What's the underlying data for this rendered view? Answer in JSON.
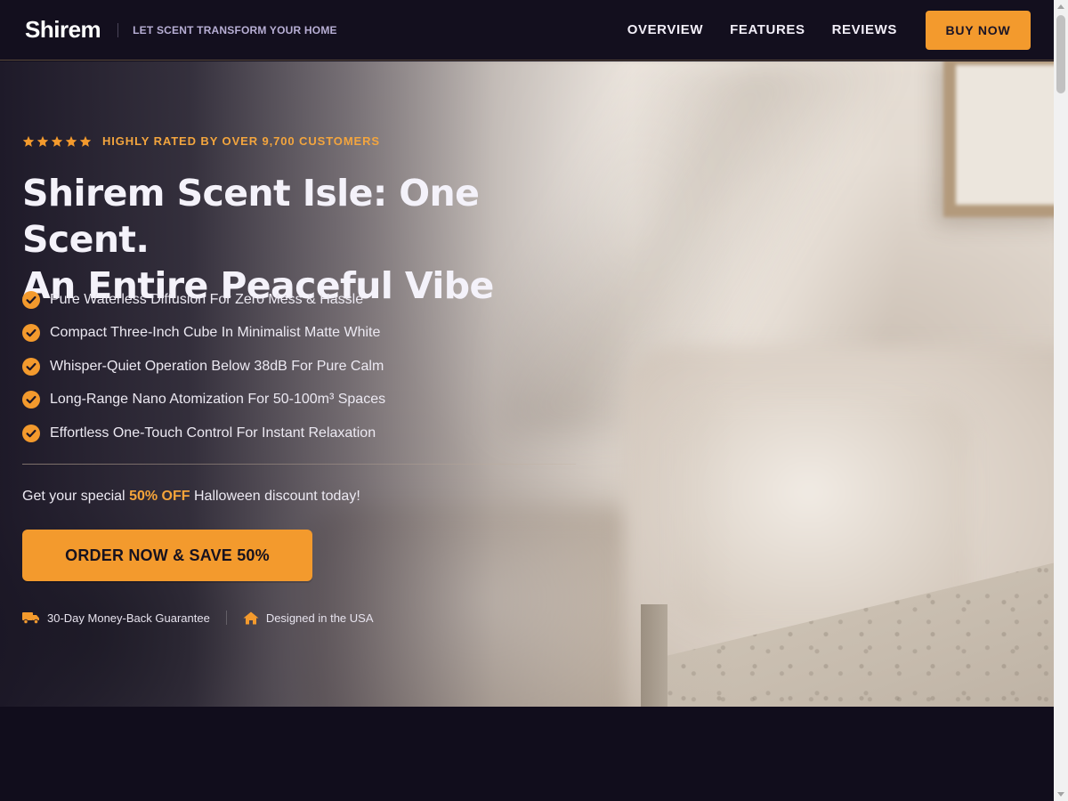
{
  "nav": {
    "logo": "Shirem",
    "tagline": "LET SCENT TRANSFORM YOUR HOME",
    "links": [
      {
        "label": "OVERVIEW"
      },
      {
        "label": "FEATURES"
      },
      {
        "label": "REVIEWS"
      }
    ],
    "cta": "BUY NOW"
  },
  "hero": {
    "rating": {
      "stars": 5,
      "text": "HIGHLY RATED BY OVER 9,700 CUSTOMERS"
    },
    "headline": {
      "line1": "Shirem Scent Isle: One Scent.",
      "line2": "An Entire Peaceful Vibe"
    },
    "features": [
      "Pure Waterless Diffusion For Zero Mess & Hassle",
      "Compact Three-Inch Cube In Minimalist Matte White",
      "Whisper-Quiet Operation Below 38dB For Pure Calm",
      "Long-Range Nano Atomization For 50-100m³ Spaces",
      "Effortless One-Touch Control For Instant Relaxation"
    ],
    "promo": {
      "before": "Get your special",
      "highlight": "50% OFF",
      "after": "Halloween discount today!"
    },
    "order_button": "ORDER NOW & SAVE 50%",
    "badges": [
      {
        "icon": "truck-icon",
        "label": "30-Day Money-Back Guarantee"
      },
      {
        "icon": "home-icon",
        "label": "Designed in the USA"
      }
    ]
  },
  "colors": {
    "accent": "#f39a2d",
    "background": "#110d1c"
  }
}
